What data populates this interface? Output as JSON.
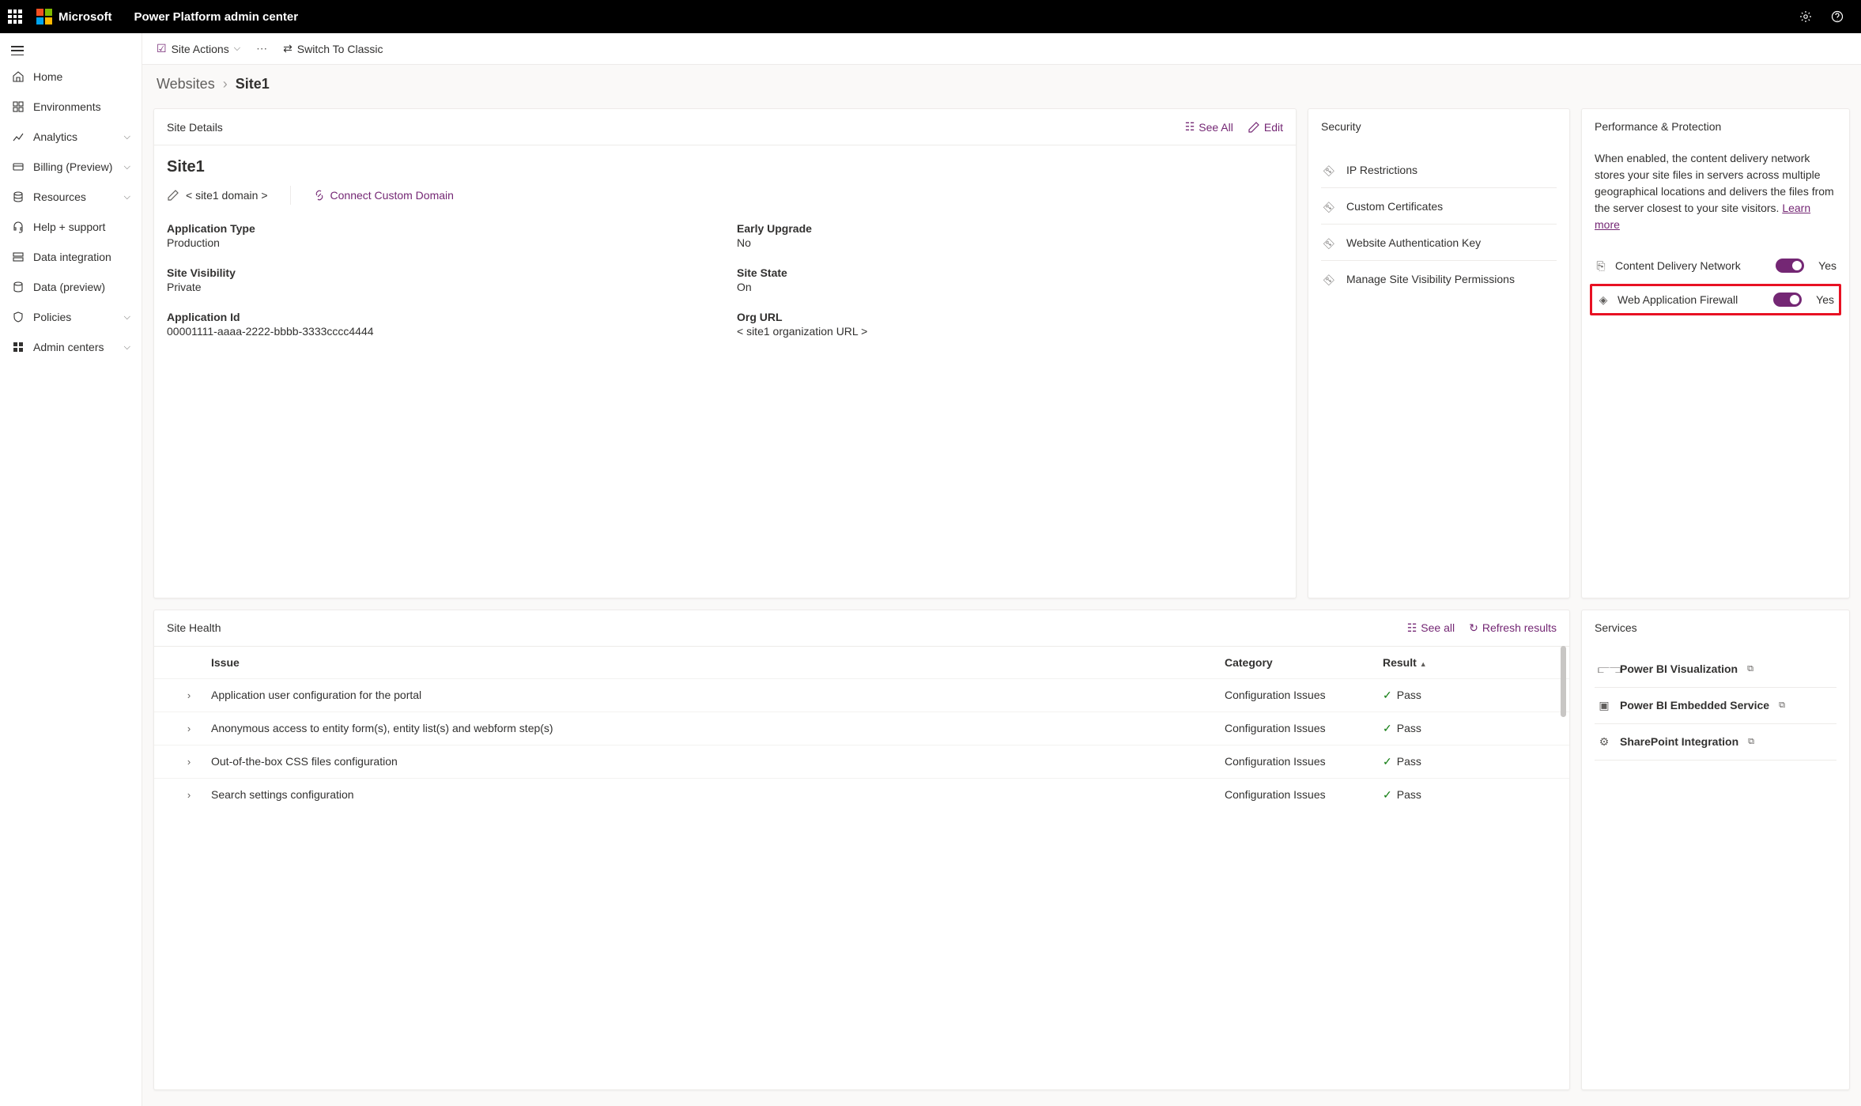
{
  "header": {
    "brand": "Microsoft",
    "app_title": "Power Platform admin center"
  },
  "nav": {
    "items": [
      {
        "label": "Home"
      },
      {
        "label": "Environments"
      },
      {
        "label": "Analytics",
        "expandable": true
      },
      {
        "label": "Billing (Preview)",
        "expandable": true
      },
      {
        "label": "Resources",
        "expandable": true
      },
      {
        "label": "Help + support"
      },
      {
        "label": "Data integration"
      },
      {
        "label": "Data (preview)"
      },
      {
        "label": "Policies",
        "expandable": true
      },
      {
        "label": "Admin centers",
        "expandable": true
      }
    ]
  },
  "toolbar": {
    "site_actions": "Site Actions",
    "switch_classic": "Switch To Classic"
  },
  "breadcrumb": {
    "root": "Websites",
    "current": "Site1"
  },
  "site_details": {
    "title": "Site Details",
    "see_all": "See All",
    "edit": "Edit",
    "site_name": "Site1",
    "domain": "< site1 domain >",
    "connect_domain": "Connect Custom Domain",
    "fields": {
      "app_type_label": "Application Type",
      "app_type_value": "Production",
      "early_upgrade_label": "Early Upgrade",
      "early_upgrade_value": "No",
      "visibility_label": "Site Visibility",
      "visibility_value": "Private",
      "state_label": "Site State",
      "state_value": "On",
      "app_id_label": "Application Id",
      "app_id_value": "00001111-aaaa-2222-bbbb-3333cccc4444",
      "org_url_label": "Org URL",
      "org_url_value": "< site1 organization URL >"
    }
  },
  "security": {
    "title": "Security",
    "items": [
      "IP Restrictions",
      "Custom Certificates",
      "Website Authentication Key",
      "Manage Site Visibility Permissions"
    ]
  },
  "perf": {
    "title": "Performance & Protection",
    "desc": "When enabled, the content delivery network stores your site files in servers across multiple geographical locations and delivers the files from the server closest to your site visitors. ",
    "learn_more": "Learn more",
    "cdn_label": "Content Delivery Network",
    "cdn_value": "Yes",
    "waf_label": "Web Application Firewall",
    "waf_value": "Yes"
  },
  "health": {
    "title": "Site Health",
    "see_all": "See all",
    "refresh": "Refresh results",
    "columns": {
      "issue": "Issue",
      "category": "Category",
      "result": "Result"
    },
    "rows": [
      {
        "issue": "Application user configuration for the portal",
        "category": "Configuration Issues",
        "result": "Pass"
      },
      {
        "issue": "Anonymous access to entity form(s), entity list(s) and webform step(s)",
        "category": "Configuration Issues",
        "result": "Pass"
      },
      {
        "issue": "Out-of-the-box CSS files configuration",
        "category": "Configuration Issues",
        "result": "Pass"
      },
      {
        "issue": "Search settings configuration",
        "category": "Configuration Issues",
        "result": "Pass"
      }
    ]
  },
  "services": {
    "title": "Services",
    "items": [
      "Power BI Visualization",
      "Power BI Embedded Service",
      "SharePoint Integration"
    ]
  }
}
